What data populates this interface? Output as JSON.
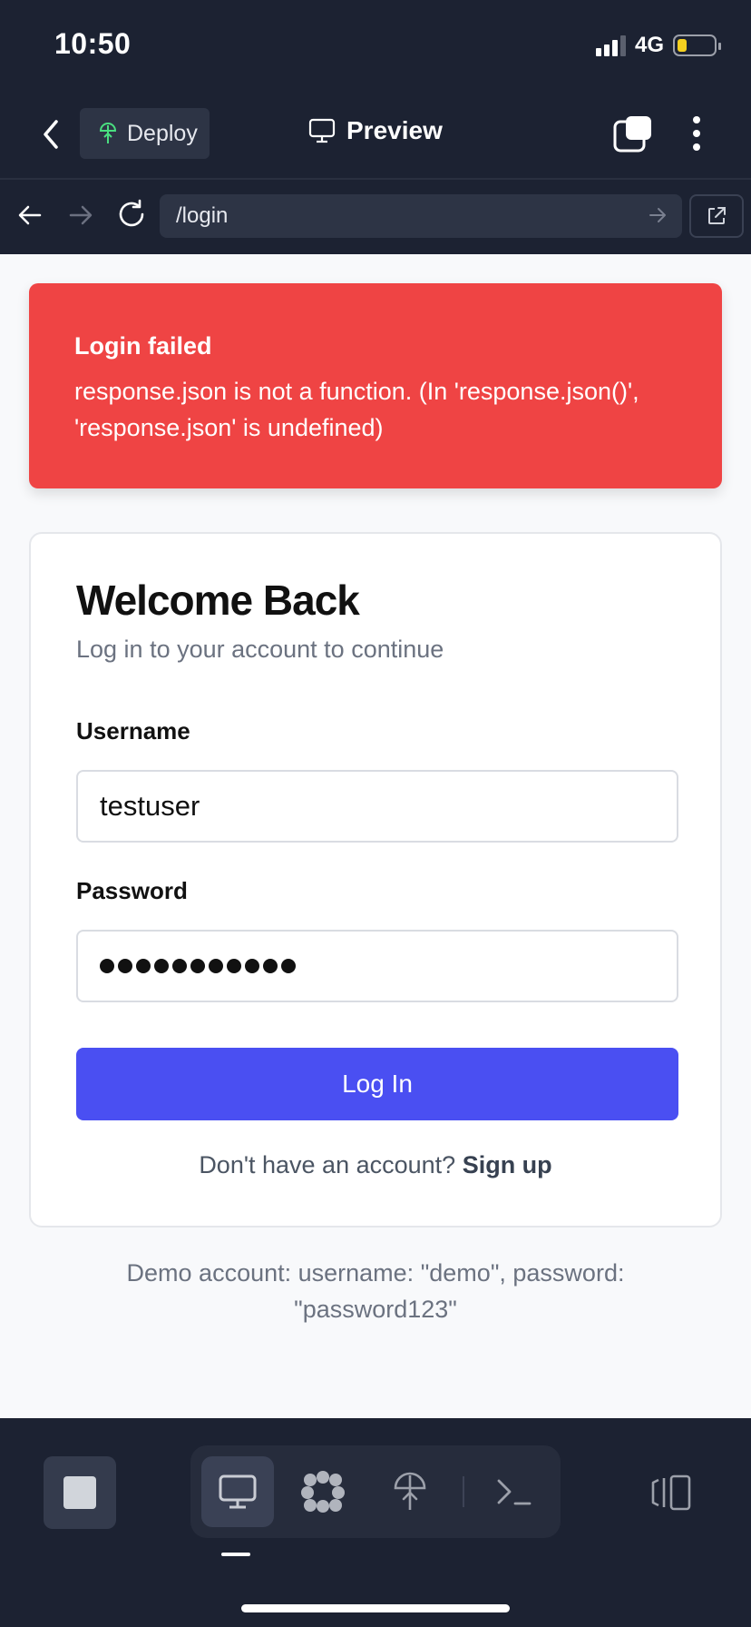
{
  "status_bar": {
    "time": "10:50",
    "network": "4G",
    "battery_percent": 25
  },
  "header": {
    "deploy_label": "Deploy",
    "title": "Preview"
  },
  "url_bar": {
    "url": "/login"
  },
  "alert": {
    "title": "Login failed",
    "message": "response.json is not a function. (In 'response.json()', 'response.json' is undefined)"
  },
  "login_card": {
    "title": "Welcome Back",
    "subtitle": "Log in to your account to continue",
    "username_label": "Username",
    "username_value": "testuser",
    "password_label": "Password",
    "password_length": 11,
    "submit_label": "Log In",
    "signup_prompt": "Don't have an account?",
    "signup_link": "Sign up"
  },
  "demo_note": "Demo account: username: \"demo\", password: \"password123\"",
  "colors": {
    "chrome_bg": "#1c2232",
    "alert_bg": "#ef4444",
    "primary_button": "#4a4ff2",
    "deploy_icon": "#4ade80",
    "battery_fill": "#f5d020"
  },
  "toolbar": {
    "items": [
      "stop-icon",
      "monitor-icon",
      "workflow-icon",
      "deploy-icon",
      "terminal-icon",
      "panel-toggle-icon"
    ],
    "active": "monitor-icon"
  }
}
